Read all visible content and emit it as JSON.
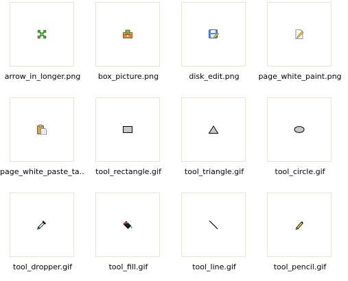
{
  "files": [
    {
      "name": "arrow_in_longer.png",
      "icon": "arrow-in-icon"
    },
    {
      "name": "box_picture.png",
      "icon": "box-picture-icon"
    },
    {
      "name": "disk_edit.png",
      "icon": "disk-edit-icon"
    },
    {
      "name": "page_white_paint.png",
      "icon": "page-white-paint-icon"
    },
    {
      "name": "page_white_paste_ta...",
      "icon": "page-white-paste-icon"
    },
    {
      "name": "tool_rectangle.gif",
      "icon": "rectangle-icon"
    },
    {
      "name": "tool_triangle.gif",
      "icon": "triangle-icon"
    },
    {
      "name": "tool_circle.gif",
      "icon": "circle-icon"
    },
    {
      "name": "tool_dropper.gif",
      "icon": "dropper-icon"
    },
    {
      "name": "tool_fill.gif",
      "icon": "fill-bucket-icon"
    },
    {
      "name": "tool_line.gif",
      "icon": "line-icon"
    },
    {
      "name": "tool_pencil.gif",
      "icon": "pencil-icon"
    }
  ],
  "colors": {
    "thumb_border": "#e9e2d5",
    "background": "#ffffff"
  }
}
